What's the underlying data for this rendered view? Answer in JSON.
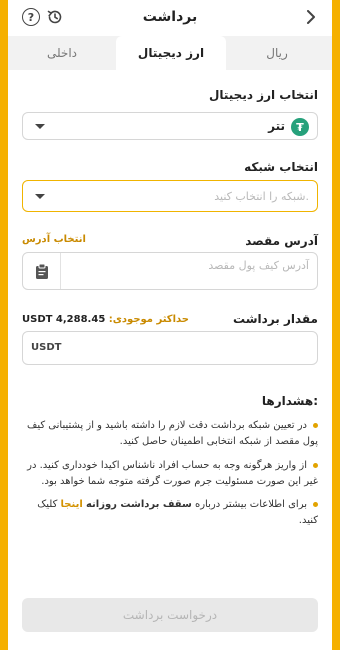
{
  "header": {
    "title": "برداشت",
    "help_label": "?"
  },
  "tabs": [
    {
      "label": "ریال"
    },
    {
      "label": "ارز دیجیتال"
    },
    {
      "label": "داخلی"
    }
  ],
  "currency_select": {
    "label": "انتخاب ارز دیجیتال",
    "value": "تتر",
    "coin_glyph": "₮"
  },
  "network_select": {
    "label": "انتخاب شبکه",
    "placeholder": "شبکه را انتخاب کنید."
  },
  "address": {
    "label": "آدرس مقصد",
    "link": "انتخاب آدرس",
    "placeholder": "آدرس کیف پول مقصد"
  },
  "amount": {
    "label": "مقدار برداشت",
    "balance_label": "حداکثر موجودی:",
    "balance_value": "USDT 4,288.45",
    "unit": "USDT"
  },
  "warnings": {
    "title": "هشدارها:",
    "items": [
      "در تعیین شبکه برداشت دقت لازم را داشته باشید و از پشتیبانی کیف پول مقصد از شبکه انتخابی اطمینان حاصل کنید.",
      "از واریز هرگونه وجه به حساب افراد ناشناس اکیدا خودداری کنید. در غیر این صورت مسئولیت جرم صورت گرفته متوجه شما خواهد بود."
    ],
    "info_prefix": "برای اطلاعات بیشتر درباره",
    "info_bold": "سقف برداشت روزانه",
    "info_link": "اینجا",
    "info_suffix": "کلیک کنید."
  },
  "submit_label": "درخواست برداشت",
  "colors": {
    "accent": "#f5b000",
    "tether": "#26a17b",
    "link": "#c98a00"
  }
}
